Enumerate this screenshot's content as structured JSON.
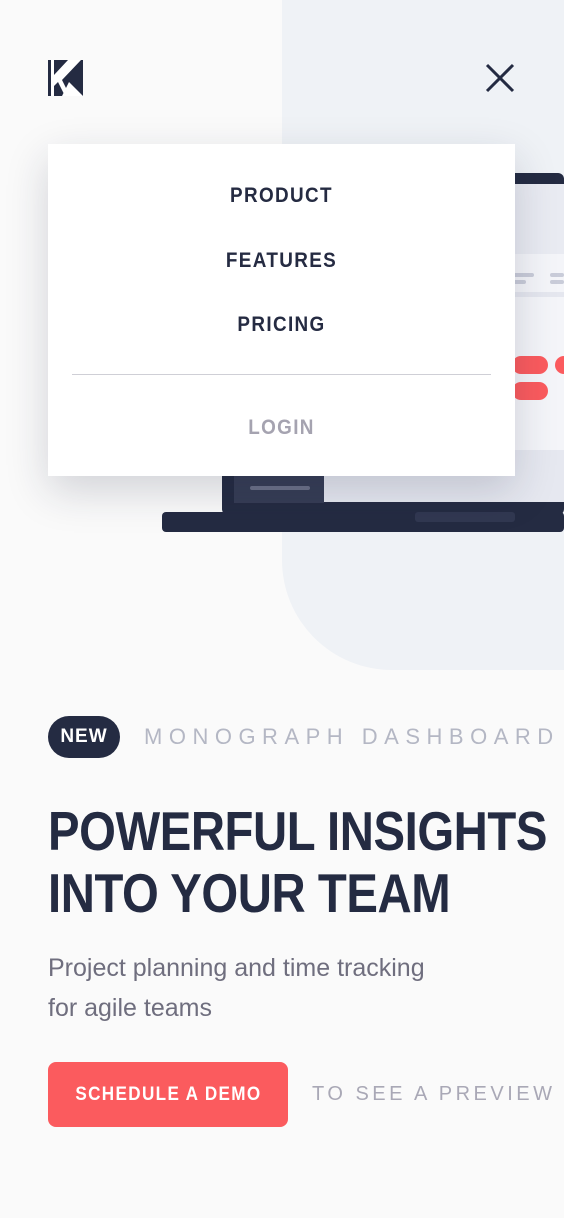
{
  "menu": {
    "items": [
      {
        "label": "PRODUCT"
      },
      {
        "label": "FEATURES"
      },
      {
        "label": "PRICING"
      }
    ],
    "login_label": "LOGIN"
  },
  "hero": {
    "badge": "NEW",
    "badge_label": "MONOGRAPH DASHBOARD",
    "headline_lines": [
      "POWERFUL INSIGHTS",
      "INTO YOUR TEAM"
    ],
    "subtitle_lines": [
      "Project planning and time tracking",
      "for agile teams"
    ],
    "cta_label": "SCHEDULE A DEMO",
    "preview_label": "TO SEE A PREVIEW"
  },
  "icons": {
    "logo": "logo-icon",
    "close": "close-icon"
  },
  "colors": {
    "dark": "#242B42",
    "accent": "#FB5B5E",
    "panel": "#EFF2F6",
    "muted": "#B4B7C4"
  }
}
